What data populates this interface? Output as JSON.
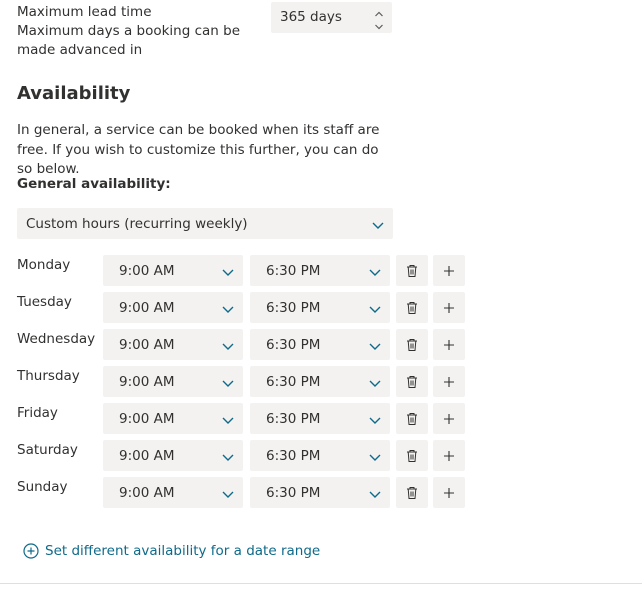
{
  "lead_time": {
    "label": "Maximum lead time",
    "description": "Maximum days a booking can be made advanced in",
    "value": "365 days"
  },
  "availability": {
    "title": "Availability",
    "description": "In general, a service can be booked when its staff are free. If you wish to customize this further, you can do so below.",
    "general_label": "General availability:",
    "general_value": "Custom hours (recurring weekly)"
  },
  "days": [
    {
      "name": "Monday",
      "start": "9:00 AM",
      "end": "6:30 PM"
    },
    {
      "name": "Tuesday",
      "start": "9:00 AM",
      "end": "6:30 PM"
    },
    {
      "name": "Wednesday",
      "start": "9:00 AM",
      "end": "6:30 PM"
    },
    {
      "name": "Thursday",
      "start": "9:00 AM",
      "end": "6:30 PM"
    },
    {
      "name": "Friday",
      "start": "9:00 AM",
      "end": "6:30 PM"
    },
    {
      "name": "Saturday",
      "start": "9:00 AM",
      "end": "6:30 PM"
    },
    {
      "name": "Sunday",
      "start": "9:00 AM",
      "end": "6:30 PM"
    }
  ],
  "date_range_link": "Set different availability for a date range",
  "colors": {
    "accent": "#0f6a8a",
    "field_bg": "#f3f2f1",
    "text": "#323130"
  },
  "icons": {
    "spin_up": "chevron-up-icon",
    "spin_down": "chevron-down-icon",
    "dropdown": "chevron-down-icon",
    "delete": "trash-icon",
    "add": "plus-icon",
    "link": "plus-circle-icon"
  }
}
